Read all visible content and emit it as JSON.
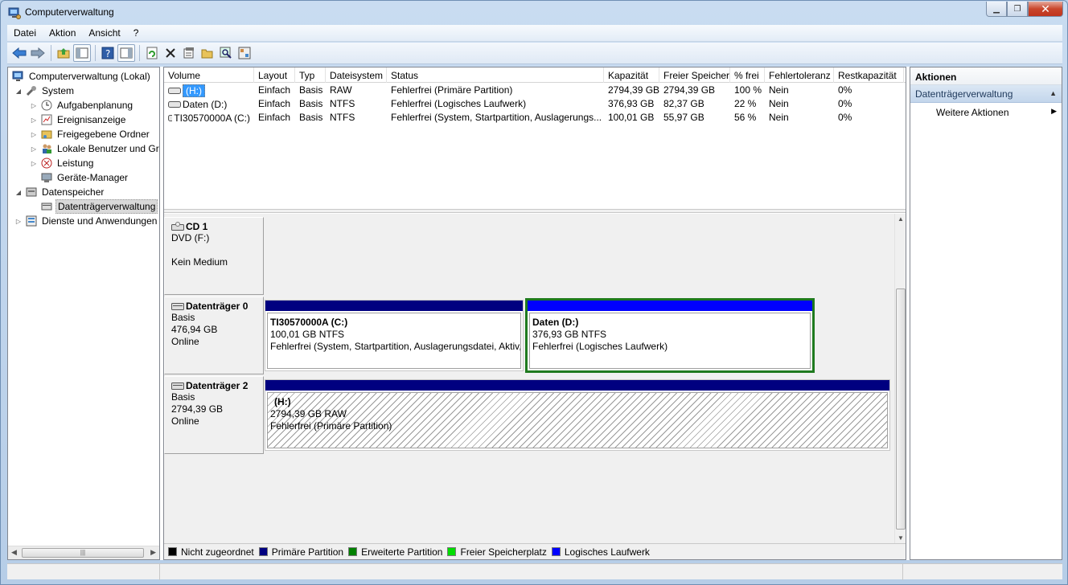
{
  "window": {
    "title": "Computerverwaltung",
    "app_icon": "computer-management-icon"
  },
  "menu": [
    "Datei",
    "Aktion",
    "Ansicht",
    "?"
  ],
  "toolbar": [
    "back-icon",
    "forward-icon",
    "up-folder-icon",
    "show-hide-console-tree-icon",
    "help-icon",
    "show-hide-action-pane-icon",
    "refresh-icon",
    "delete-icon",
    "properties-icon",
    "open-folder-icon",
    "search-icon",
    "settings-icon"
  ],
  "tree": [
    {
      "label": "Computerverwaltung (Lokal)",
      "level": 0,
      "expand": "",
      "icon": "computer-management-icon"
    },
    {
      "label": "System",
      "level": 1,
      "expand": "◢",
      "icon": "tools-icon"
    },
    {
      "label": "Aufgabenplanung",
      "level": 2,
      "expand": "▷",
      "icon": "clock-icon"
    },
    {
      "label": "Ereignisanzeige",
      "level": 2,
      "expand": "▷",
      "icon": "event-viewer-icon"
    },
    {
      "label": "Freigegebene Ordner",
      "level": 2,
      "expand": "▷",
      "icon": "shared-folder-icon"
    },
    {
      "label": "Lokale Benutzer und Gruppen",
      "level": 2,
      "expand": "▷",
      "icon": "users-icon"
    },
    {
      "label": "Leistung",
      "level": 2,
      "expand": "▷",
      "icon": "performance-icon"
    },
    {
      "label": "Geräte-Manager",
      "level": 2,
      "expand": "",
      "icon": "device-manager-icon"
    },
    {
      "label": "Datenspeicher",
      "level": 1,
      "expand": "◢",
      "icon": "storage-icon"
    },
    {
      "label": "Datenträgerverwaltung",
      "level": 2,
      "expand": "",
      "icon": "disk-management-icon",
      "selected": true
    },
    {
      "label": "Dienste und Anwendungen",
      "level": 1,
      "expand": "▷",
      "icon": "services-icon"
    }
  ],
  "volumes": {
    "columns": [
      "Volume",
      "Layout",
      "Typ",
      "Dateisystem",
      "Status",
      "Kapazität",
      "Freier Speicher",
      "% frei",
      "Fehlertoleranz",
      "Restkapazität"
    ],
    "rows": [
      {
        "name": "(H:)",
        "layout": "Einfach",
        "type": "Basis",
        "fs": "RAW",
        "status": "Fehlerfrei (Primäre Partition)",
        "capacity": "2794,39 GB",
        "free": "2794,39 GB",
        "pct": "100 %",
        "fault": "Nein",
        "overhead": "0%",
        "highlight": true
      },
      {
        "name": "Daten (D:)",
        "layout": "Einfach",
        "type": "Basis",
        "fs": "NTFS",
        "status": "Fehlerfrei (Logisches Laufwerk)",
        "capacity": "376,93 GB",
        "free": "82,37 GB",
        "pct": "22 %",
        "fault": "Nein",
        "overhead": "0%"
      },
      {
        "name": "TI30570000A (C:)",
        "layout": "Einfach",
        "type": "Basis",
        "fs": "NTFS",
        "status": "Fehlerfrei (System, Startpartition, Auslagerungs...",
        "capacity": "100,01 GB",
        "free": "55,97 GB",
        "pct": "56 %",
        "fault": "Nein",
        "overhead": "0%"
      }
    ]
  },
  "disks": {
    "cd1": {
      "title": "CD 1",
      "lines": [
        "DVD (F:)",
        "",
        "Kein Medium"
      ]
    },
    "disk0": {
      "title": "Datenträger 0",
      "lines": [
        "Basis",
        "476,94 GB",
        "Online"
      ],
      "partitions": [
        {
          "title": "TI30570000A  (C:)",
          "line1": "100,01 GB NTFS",
          "line2": "Fehlerfrei (System, Startpartition, Auslagerungsdatei, Aktiv, A"
        },
        {
          "title": "Daten  (D:)",
          "line1": "376,93 GB NTFS",
          "line2": "Fehlerfrei (Logisches Laufwerk)"
        }
      ]
    },
    "disk2": {
      "title": "Datenträger 2",
      "lines": [
        "Basis",
        "2794,39 GB",
        "Online"
      ],
      "partitions": [
        {
          "title": "(H:)",
          "line1": "2794,39 GB RAW",
          "line2": "Fehlerfrei (Primäre Partition)"
        }
      ]
    }
  },
  "legend": [
    {
      "label": "Nicht zugeordnet",
      "color": "#000000"
    },
    {
      "label": "Primäre Partition",
      "color": "#000080"
    },
    {
      "label": "Erweiterte Partition",
      "color": "#008000"
    },
    {
      "label": "Freier Speicherplatz",
      "color": "#00dd00"
    },
    {
      "label": "Logisches Laufwerk",
      "color": "#0000ff"
    }
  ],
  "actions": {
    "header": "Aktionen",
    "section": "Datenträgerverwaltung",
    "item": "Weitere Aktionen"
  },
  "colors": {
    "primary": "#000080",
    "extended": "#008000",
    "logical": "#0000ff"
  }
}
